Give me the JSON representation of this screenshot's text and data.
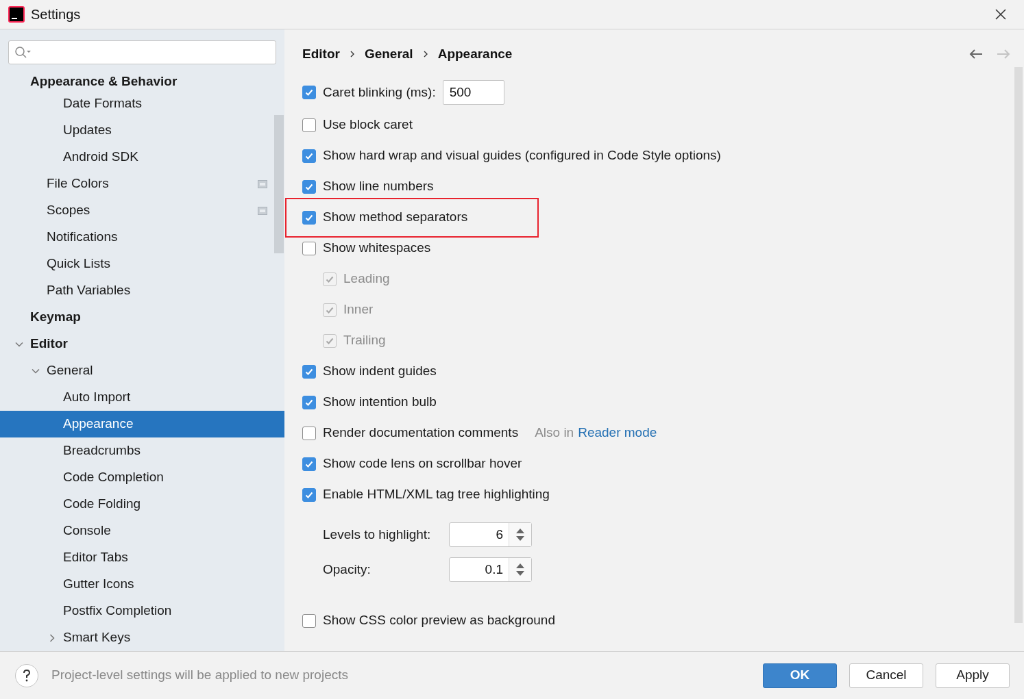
{
  "window": {
    "title": "Settings"
  },
  "tree": [
    {
      "label": "Appearance & Behavior",
      "selected": false,
      "children": [
        {
          "children": [
            {
              "label": "Date Formats",
              "selected": false
            },
            {
              "label": "Updates",
              "selected": false
            },
            {
              "label": "Android SDK",
              "selected": false
            }
          ]
        },
        {
          "label": "File Colors",
          "selected": false,
          "project_level": true
        },
        {
          "label": "Scopes",
          "selected": false,
          "project_level": true
        },
        {
          "label": "Notifications",
          "selected": false
        },
        {
          "label": "Quick Lists",
          "selected": false
        },
        {
          "label": "Path Variables",
          "selected": false
        }
      ]
    },
    {
      "label": "Keymap",
      "selected": false
    },
    {
      "label": "Editor",
      "selected": false,
      "expanded": true,
      "show_arrow": true,
      "children": [
        {
          "label": "General",
          "selected": false,
          "expanded": true,
          "show_arrow": true,
          "children": [
            {
              "label": "Auto Import",
              "selected": false
            },
            {
              "label": "Appearance",
              "selected": true
            },
            {
              "label": "Breadcrumbs",
              "selected": false
            },
            {
              "label": "Code Completion",
              "selected": false
            },
            {
              "label": "Code Folding",
              "selected": false
            },
            {
              "label": "Console",
              "selected": false
            },
            {
              "label": "Editor Tabs",
              "selected": false
            },
            {
              "label": "Gutter Icons",
              "selected": false
            },
            {
              "label": "Postfix Completion",
              "selected": false
            },
            {
              "label": "Smart Keys",
              "selected": false,
              "expanded": false,
              "show_arrow": true
            }
          ]
        }
      ]
    }
  ],
  "breadcrumbs": [
    "Editor",
    "General",
    "Appearance"
  ],
  "options": [
    {
      "kind": "checkbox",
      "label": "Caret blinking (ms):",
      "checked": true,
      "value": "500"
    },
    {
      "kind": "checkbox",
      "label": "Use block caret",
      "checked": false
    },
    {
      "kind": "checkbox",
      "label": "Show hard wrap and visual guides (configured in Code Style options)",
      "checked": true
    },
    {
      "kind": "checkbox",
      "label": "Show line numbers",
      "checked": true
    },
    {
      "kind": "checkbox",
      "label": "Show method separators",
      "checked": true,
      "highlighted": true
    },
    {
      "kind": "checkbox",
      "label": "Show whitespaces",
      "checked": false
    },
    {
      "kind": "subcheckbox",
      "label": "Leading",
      "checked": true,
      "disabled": true
    },
    {
      "kind": "subcheckbox",
      "label": "Inner",
      "checked": true,
      "disabled": true
    },
    {
      "kind": "subcheckbox",
      "label": "Trailing",
      "checked": true,
      "disabled": true
    },
    {
      "kind": "checkbox",
      "label": "Show indent guides",
      "checked": true
    },
    {
      "kind": "checkbox",
      "label": "Show intention bulb",
      "checked": true
    },
    {
      "kind": "checkbox",
      "label": "Render documentation comments",
      "checked": false,
      "note": "Also in",
      "link": "Reader mode"
    },
    {
      "kind": "checkbox",
      "label": "Show code lens on scrollbar hover",
      "checked": true
    },
    {
      "kind": "checkbox",
      "label": "Enable HTML/XML tag tree highlighting",
      "checked": true
    },
    {
      "kind": "spinner",
      "label": "Levels to highlight:",
      "value": "6"
    },
    {
      "kind": "spinner",
      "label": "Opacity:",
      "value": "0.1"
    },
    {
      "kind": "checkbox",
      "label": "Show CSS color preview as background",
      "checked": false
    }
  ],
  "footer": {
    "hint": "Project-level settings will be applied to new projects",
    "buttons": [
      {
        "label": "OK",
        "primary": true
      },
      {
        "label": "Cancel",
        "primary": false
      },
      {
        "label": "Apply",
        "primary": false
      }
    ]
  }
}
